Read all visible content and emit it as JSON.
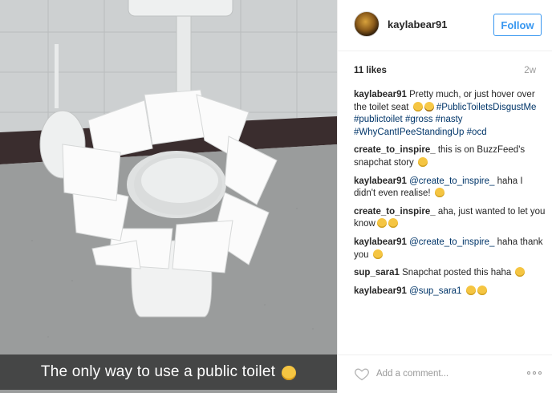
{
  "post": {
    "caption_overlay": "The only way to use a public toilet",
    "caption_emoji": "laughing-crying-emoji"
  },
  "header": {
    "username": "kaylabear91",
    "follow_label": "Follow"
  },
  "meta": {
    "likes": "11 likes",
    "time": "2w"
  },
  "comments": [
    {
      "user": "kaylabear91",
      "parts": [
        {
          "t": "text",
          "v": " Pretty much, or just hover over the toilet seat "
        },
        {
          "t": "emoji",
          "v": "laughing-crying-emoji"
        },
        {
          "t": "emoji",
          "v": "grimace-emoji"
        },
        {
          "t": "text",
          "v": " "
        },
        {
          "t": "tag",
          "v": "#PublicToiletsDisgustMe"
        },
        {
          "t": "text",
          "v": " "
        },
        {
          "t": "tag",
          "v": "#publictoilet"
        },
        {
          "t": "text",
          "v": " "
        },
        {
          "t": "tag",
          "v": "#gross"
        },
        {
          "t": "text",
          "v": " "
        },
        {
          "t": "tag",
          "v": "#nasty"
        },
        {
          "t": "text",
          "v": " "
        },
        {
          "t": "tag",
          "v": "#WhyCantIPeeStandingUp"
        },
        {
          "t": "text",
          "v": " "
        },
        {
          "t": "tag",
          "v": "#ocd"
        }
      ]
    },
    {
      "user": "create_to_inspire_",
      "parts": [
        {
          "t": "text",
          "v": " this is on BuzzFeed's snapchat story "
        },
        {
          "t": "emoji",
          "v": "laughing-crying-emoji"
        }
      ]
    },
    {
      "user": "kaylabear91",
      "parts": [
        {
          "t": "text",
          "v": " "
        },
        {
          "t": "mention",
          "v": "@create_to_inspire_"
        },
        {
          "t": "text",
          "v": " haha I didn't even realise! "
        },
        {
          "t": "emoji",
          "v": "laughing-crying-emoji"
        }
      ]
    },
    {
      "user": "create_to_inspire_",
      "parts": [
        {
          "t": "text",
          "v": " aha, just wanted to let you know"
        },
        {
          "t": "emoji",
          "v": "laughing-crying-emoji"
        },
        {
          "t": "emoji",
          "v": "laughing-crying-emoji"
        }
      ]
    },
    {
      "user": "kaylabear91",
      "parts": [
        {
          "t": "text",
          "v": " "
        },
        {
          "t": "mention",
          "v": "@create_to_inspire_"
        },
        {
          "t": "text",
          "v": " haha thank you "
        },
        {
          "t": "emoji",
          "v": "tongue-out-emoji"
        }
      ]
    },
    {
      "user": "sup_sara1",
      "parts": [
        {
          "t": "text",
          "v": " Snapchat posted this haha "
        },
        {
          "t": "emoji",
          "v": "laughing-crying-emoji"
        }
      ]
    },
    {
      "user": "kaylabear91",
      "parts": [
        {
          "t": "text",
          "v": " "
        },
        {
          "t": "mention",
          "v": "@sup_sara1"
        },
        {
          "t": "text",
          "v": " "
        },
        {
          "t": "emoji",
          "v": "laughing-crying-emoji"
        },
        {
          "t": "emoji",
          "v": "laughing-crying-emoji"
        }
      ]
    }
  ],
  "footer": {
    "comment_placeholder": "Add a comment...",
    "like_icon": "heart-outline-icon",
    "more_icon": "more-options-icon"
  },
  "colors": {
    "accent": "#3897f0",
    "link": "#003569",
    "muted": "#999999"
  }
}
